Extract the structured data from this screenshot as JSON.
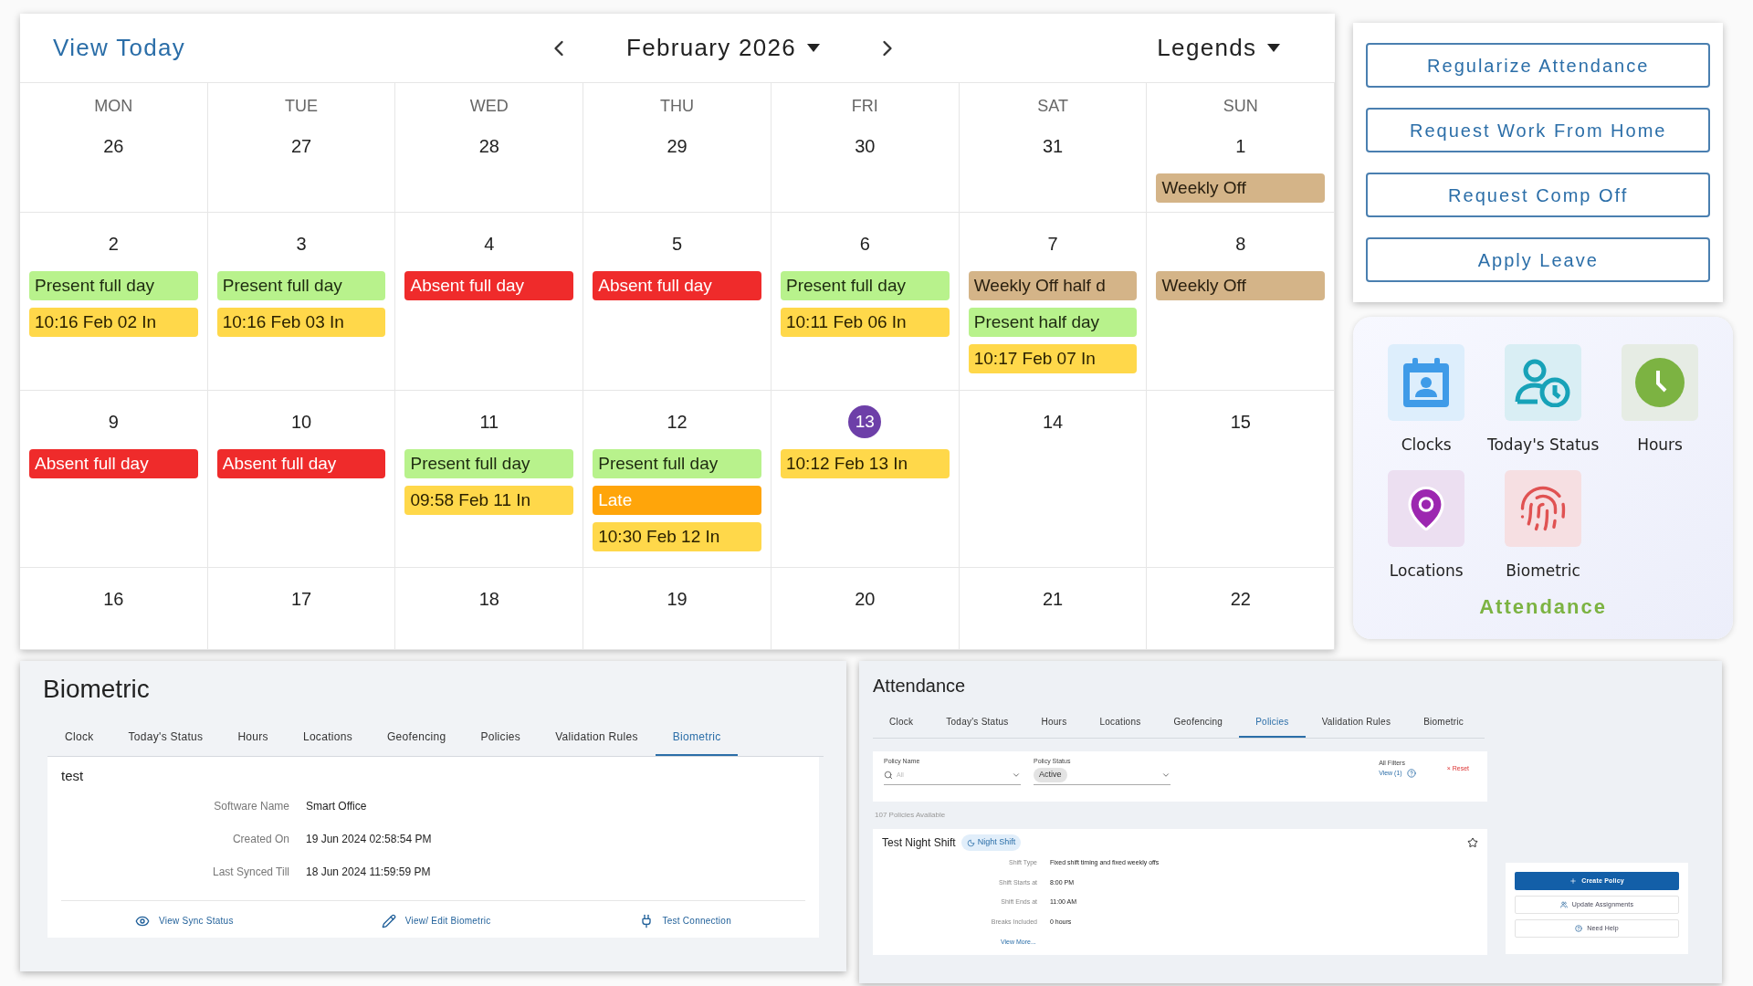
{
  "calendar": {
    "view_today": "View Today",
    "month": "February 2026",
    "legends": "Legends",
    "weekdays": [
      "MON",
      "TUE",
      "WED",
      "THU",
      "FRI",
      "SAT",
      "SUN"
    ],
    "weeks": [
      [
        {
          "date": "26",
          "today": false
        },
        {
          "date": "27",
          "today": false
        },
        {
          "date": "28",
          "today": false
        },
        {
          "date": "29",
          "today": false
        },
        {
          "date": "30",
          "today": false
        },
        {
          "date": "31",
          "today": false
        },
        {
          "date": "1",
          "today": false,
          "events": [
            {
              "label": "Weekly Off",
              "kind": "off"
            }
          ]
        }
      ],
      [
        {
          "date": "2",
          "today": false,
          "events": [
            {
              "label": "Present full day",
              "kind": "present"
            },
            {
              "label": "10:16 Feb 02 In",
              "kind": "punch"
            }
          ]
        },
        {
          "date": "3",
          "today": false,
          "events": [
            {
              "label": "Present full day",
              "kind": "present"
            },
            {
              "label": "10:16 Feb 03 In",
              "kind": "punch"
            }
          ]
        },
        {
          "date": "4",
          "today": false,
          "events": [
            {
              "label": "Absent full day",
              "kind": "absent"
            }
          ]
        },
        {
          "date": "5",
          "today": false,
          "events": [
            {
              "label": "Absent full day",
              "kind": "absent"
            }
          ]
        },
        {
          "date": "6",
          "today": false,
          "events": [
            {
              "label": "Present full day",
              "kind": "present"
            },
            {
              "label": "10:11 Feb 06 In",
              "kind": "punch"
            }
          ]
        },
        {
          "date": "7",
          "today": false,
          "events": [
            {
              "label": "Weekly Off half d",
              "kind": "off"
            },
            {
              "label": "Present half day",
              "kind": "present"
            },
            {
              "label": "10:17 Feb 07 In",
              "kind": "punch"
            }
          ]
        },
        {
          "date": "8",
          "today": false,
          "events": [
            {
              "label": "Weekly Off",
              "kind": "off"
            }
          ]
        }
      ],
      [
        {
          "date": "9",
          "today": false,
          "events": [
            {
              "label": "Absent full day",
              "kind": "absent"
            }
          ]
        },
        {
          "date": "10",
          "today": false,
          "events": [
            {
              "label": "Absent full day",
              "kind": "absent"
            }
          ]
        },
        {
          "date": "11",
          "today": false,
          "events": [
            {
              "label": "Present full day",
              "kind": "present"
            },
            {
              "label": "09:58 Feb 11 In",
              "kind": "punch"
            }
          ]
        },
        {
          "date": "12",
          "today": false,
          "events": [
            {
              "label": "Present full day",
              "kind": "present"
            },
            {
              "label": "Late",
              "kind": "late"
            },
            {
              "label": "10:30 Feb 12 In",
              "kind": "punch"
            }
          ]
        },
        {
          "date": "13",
          "today": true,
          "events": [
            {
              "label": "10:12 Feb 13 In",
              "kind": "punch"
            }
          ]
        },
        {
          "date": "14",
          "today": false
        },
        {
          "date": "15",
          "today": false
        }
      ],
      [
        {
          "date": "16",
          "today": false
        },
        {
          "date": "17",
          "today": false
        },
        {
          "date": "18",
          "today": false
        },
        {
          "date": "19",
          "today": false
        },
        {
          "date": "20",
          "today": false
        },
        {
          "date": "21",
          "today": false
        },
        {
          "date": "22",
          "today": false
        }
      ]
    ]
  },
  "actions": [
    "Regularize Attendance",
    "Request Work From Home",
    "Request Comp Off",
    "Apply Leave"
  ],
  "attendance_widget": {
    "tiles": [
      {
        "label": "Clocks",
        "kind": "calendar"
      },
      {
        "label": "Today's Status",
        "kind": "status"
      },
      {
        "label": "Hours",
        "kind": "clock"
      },
      {
        "label": "Locations",
        "kind": "pin"
      },
      {
        "label": "Biometric",
        "kind": "fingerprint"
      }
    ],
    "title": "Attendance"
  },
  "biometric_panel": {
    "title": "Biometric",
    "tabs": [
      {
        "label": "Clock",
        "selected": false
      },
      {
        "label": "Today's Status",
        "selected": false
      },
      {
        "label": "Hours",
        "selected": false
      },
      {
        "label": "Locations",
        "selected": false
      },
      {
        "label": "Geofencing",
        "selected": false
      },
      {
        "label": "Policies",
        "selected": false
      },
      {
        "label": "Validation Rules",
        "selected": false
      },
      {
        "label": "Biometric",
        "selected": true
      }
    ],
    "name": "test",
    "fields": [
      {
        "label": "Software Name",
        "value": "Smart Office"
      },
      {
        "label": "Created On",
        "value": "19 Jun 2024 02:58:54 PM"
      },
      {
        "label": "Last Synced Till",
        "value": "18 Jun 2024 11:59:59 PM"
      }
    ],
    "links": [
      {
        "label": "View Sync Status",
        "kind": "eye"
      },
      {
        "label": "View/ Edit Biometric",
        "kind": "pen"
      },
      {
        "label": "Test Connection",
        "kind": "plug"
      }
    ]
  },
  "attendance_panel": {
    "title": "Attendance",
    "tabs": [
      {
        "label": "Clock",
        "selected": false
      },
      {
        "label": "Today's Status",
        "selected": false
      },
      {
        "label": "Hours",
        "selected": false
      },
      {
        "label": "Locations",
        "selected": false
      },
      {
        "label": "Geofencing",
        "selected": false
      },
      {
        "label": "Policies",
        "selected": true
      },
      {
        "label": "Validation Rules",
        "selected": false
      },
      {
        "label": "Biometric",
        "selected": false
      }
    ],
    "filters": {
      "policy_name_label": "Policy Name",
      "policy_name_placeholder": "All",
      "policy_status_label": "Policy Status",
      "policy_status_chip": "Active",
      "all_filters_label": "All Filters",
      "view_link": "View (1)",
      "reset": "× Reset"
    },
    "count": "107 Policies Available",
    "policy": {
      "name": "Test Night Shift",
      "badge": "Night Shift",
      "fields": [
        {
          "label": "Shift Type",
          "value": "Fixed shift timing and fixed weekly offs"
        },
        {
          "label": "Shift Starts at",
          "value": "8:00 PM"
        },
        {
          "label": "Shift Ends at",
          "value": "11:00 AM"
        },
        {
          "label": "Breaks Included",
          "value": "0 hours"
        }
      ],
      "view_more": "View More..."
    },
    "buttons": [
      {
        "label": "Create Policy",
        "kind": "primary"
      },
      {
        "label": "Update Assignments",
        "kind": "users"
      },
      {
        "label": "Need Help",
        "kind": "help"
      }
    ]
  }
}
